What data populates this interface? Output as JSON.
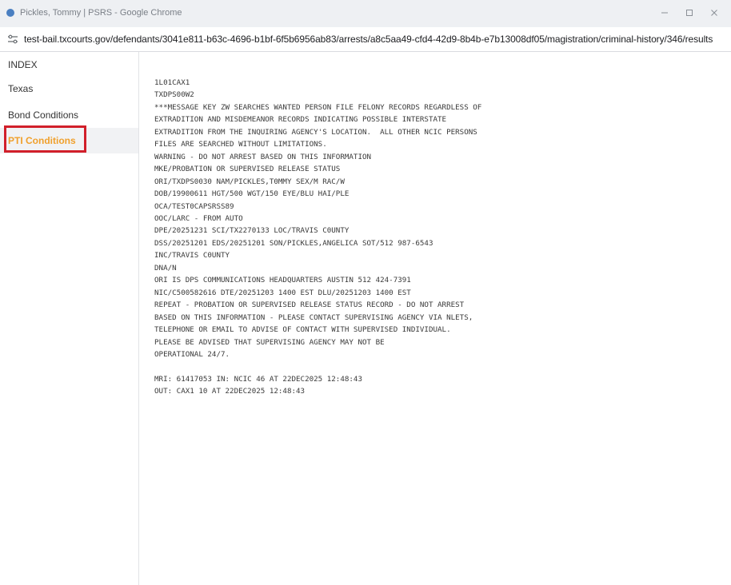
{
  "window": {
    "title": "Pickles, Tommy | PSRS - Google Chrome",
    "controls": {
      "minimize_icon": "minimize-icon",
      "maximize_icon": "maximize-icon",
      "close_icon": "close-icon"
    }
  },
  "address_bar": {
    "url": "test-bail.txcourts.gov/defendants/3041e811-b63c-4696-b1bf-6f5b6956ab83/arrests/a8c5aa49-cfd4-42d9-8b4b-e7b13008df05/magistration/criminal-history/346/results",
    "icon": "site-info-icon"
  },
  "sidebar": {
    "items": [
      {
        "label": "INDEX"
      },
      {
        "label": "Texas"
      },
      {
        "label": "Bond Conditions"
      },
      {
        "label": "PTI Conditions",
        "active": true
      }
    ],
    "active_color": "#f0a02c",
    "highlight_color": "#d11f2a"
  },
  "report": {
    "lines": [
      "1L01CAX1",
      "TXDPS00W2",
      "***MESSAGE KEY ZW SEARCHES WANTED PERSON FILE FELONY RECORDS REGARDLESS OF",
      "EXTRADITION AND MISDEMEANOR RECORDS INDICATING POSSIBLE INTERSTATE",
      "EXTRADITION FROM THE INQUIRING AGENCY'S LOCATION.  ALL OTHER NCIC PERSONS",
      "FILES ARE SEARCHED WITHOUT LIMITATIONS.",
      "WARNING - DO NOT ARREST BASED ON THIS INFORMATION",
      "MKE/PROBATION OR SUPERVISED RELEASE STATUS",
      "ORI/TXDPS0030 NAM/PICKLES,T0MMY SEX/M RAC/W",
      "DOB/19900611 HGT/500 WGT/150 EYE/BLU HAI/PLE",
      "OCA/TEST0CAPSRSS89",
      "OOC/LARC - FROM AUTO",
      "DPE/20251231 SCI/TX2270133 LOC/TRAVIS C0UNTY",
      "DSS/20251201 EDS/20251201 SON/PICKLES,ANGELICA SOT/512 987-6543",
      "INC/TRAVIS C0UNTY",
      "DNA/N",
      "ORI IS DPS COMMUNICATIONS HEADQUARTERS AUSTIN 512 424-7391",
      "NIC/C500582616 DTE/20251203 1400 EST DLU/20251203 1400 EST",
      "REPEAT - PROBATION OR SUPERVISED RELEASE STATUS RECORD - DO NOT ARREST",
      "BASED ON THIS INFORMATION - PLEASE CONTACT SUPERVISING AGENCY VIA NLETS,",
      "TELEPHONE OR EMAIL TO ADVISE OF CONTACT WITH SUPERVISED INDIVIDUAL.",
      "PLEASE BE ADVISED THAT SUPERVISING AGENCY MAY NOT BE",
      "OPERATIONAL 24/7.",
      "",
      "MRI: 61417053 IN: NCIC 46 AT 22DEC2025 12:48:43",
      "OUT: CAX1 10 AT 22DEC2025 12:48:43"
    ]
  }
}
